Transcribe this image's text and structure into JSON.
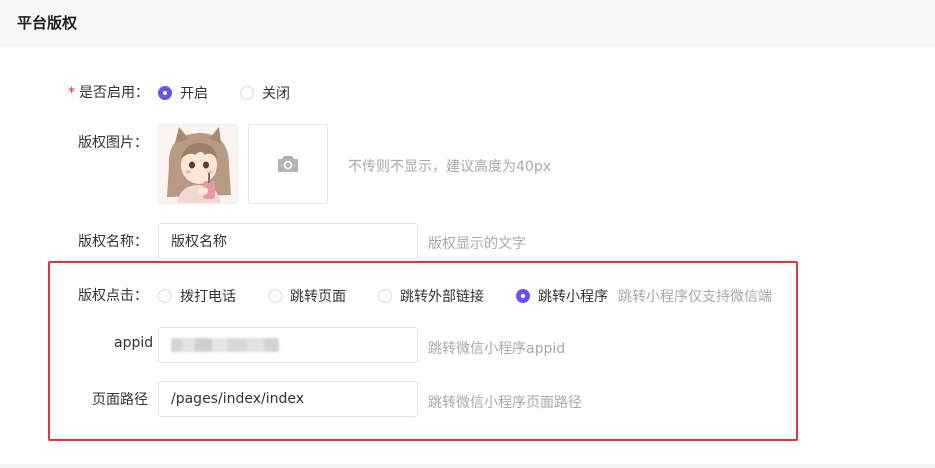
{
  "header": {
    "title": "平台版权"
  },
  "enable": {
    "label": "是否启用：",
    "required_mark": "*",
    "options": [
      {
        "label": "开启",
        "checked": true
      },
      {
        "label": "关闭",
        "checked": false
      }
    ]
  },
  "image": {
    "label": "版权图片：",
    "hint": "不传则不显示，建议高度为40px",
    "upload_icon": "camera-icon"
  },
  "name": {
    "label": "版权名称：",
    "value": "版权名称",
    "hint": "版权显示的文字"
  },
  "click": {
    "label": "版权点击：",
    "options": [
      {
        "label": "拨打电话",
        "checked": false
      },
      {
        "label": "跳转页面",
        "checked": false
      },
      {
        "label": "跳转外部链接",
        "checked": false
      },
      {
        "label": "跳转小程序",
        "checked": true
      }
    ],
    "hint": "跳转小程序仅支持微信端"
  },
  "appid": {
    "label": "appid",
    "hint": "跳转微信小程序appid"
  },
  "path": {
    "label": "页面路径",
    "value": "/pages/index/index",
    "hint": "跳转微信小程序页面路径"
  },
  "colors": {
    "accent": "#6f50ee",
    "highlight": "#e8323c",
    "required": "#f5222d"
  }
}
